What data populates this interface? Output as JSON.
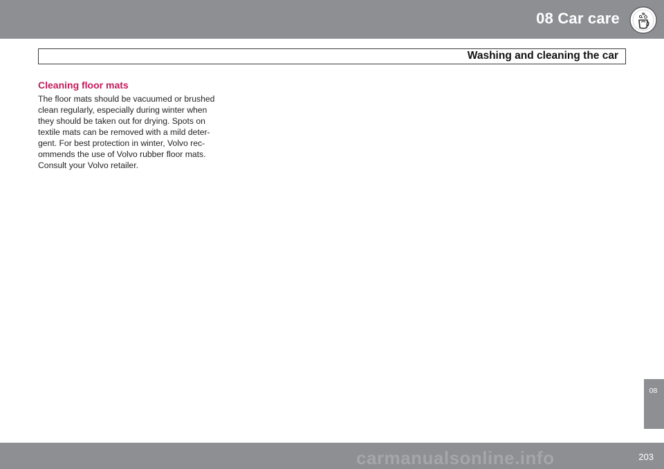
{
  "header": {
    "chapter_title": "08 Car care",
    "chapter_icon": "car-care-icon",
    "band_color": "#8e8f93"
  },
  "section": {
    "title": "Washing and cleaning the car"
  },
  "content": {
    "heading": "Cleaning floor mats",
    "heading_color": "#c41a5b",
    "body_lines": [
      "The floor mats should be vacuumed or brushed",
      "clean regularly, especially during winter when",
      "they should be taken out for drying. Spots on",
      "textile mats can be removed with a mild deter-",
      "gent. For best protection in winter, Volvo rec-",
      "ommends the use of Volvo rubber floor mats.",
      "Consult your Volvo retailer."
    ]
  },
  "side_tab": {
    "label": "08"
  },
  "footer": {
    "page_number": "203",
    "watermark": "carmanualsonline.info"
  }
}
